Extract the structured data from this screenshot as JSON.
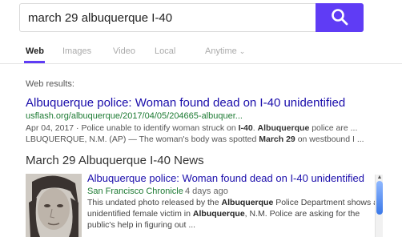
{
  "search": {
    "query": "march 29 albuquerque I-40",
    "button_icon": "search-icon"
  },
  "tabs": [
    {
      "label": "Web",
      "active": true
    },
    {
      "label": "Images",
      "active": false
    },
    {
      "label": "Video",
      "active": false
    },
    {
      "label": "Local",
      "active": false
    },
    {
      "label": "Anytime",
      "active": false
    }
  ],
  "web_results_label": "Web results:",
  "result1": {
    "title": "Albuquerque police: Woman found dead on I-40 unidentified",
    "url": "usflash.org/albuquerque/2017/04/05/204665-albuquer...",
    "line1": {
      "date": "Apr 04, 2017",
      "sep": " · ",
      "t1": "Police unable to identify woman struck on ",
      "b1": "I-40",
      "t2": ". ",
      "b2": "Albuquerque",
      "t3": " police are ..."
    },
    "line2": {
      "t1": "LBUQUERQUE, N.M. (AP) — The woman's body was spotted ",
      "b1": "March 29",
      "t2": " on westbound I ..."
    }
  },
  "news": {
    "heading": "March 29 Albuquerque I-40 News",
    "thumbnail_alt": "news-photo",
    "title": "Albuquerque police: Woman found dead on I-40 unidentified",
    "source": "San Francisco Chronicle",
    "age": "4 days ago",
    "line1": {
      "t1": "This undated photo released by the ",
      "b1": "Albuquerque",
      "t2": " Police Department shows an"
    },
    "line2": {
      "t1": "unidentified female victim in ",
      "b1": "Albuquerque",
      "t2": ", N.M. Police are asking for the"
    },
    "line3": {
      "t1": "public's help in figuring out ..."
    }
  },
  "colors": {
    "accent": "#5f3cf5",
    "link": "#1a0dab",
    "url": "#1e7b34"
  }
}
